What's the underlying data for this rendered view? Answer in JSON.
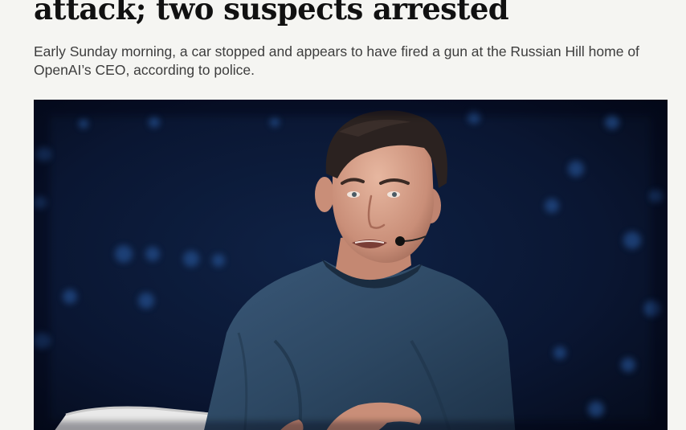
{
  "article": {
    "headline": "attack; two suspects arrested",
    "dek": "Early Sunday morning, a car stopped and appears to have fired a gun at the Russian Hill home of OpenAI’s CEO, according to police."
  },
  "hero_image": {
    "subject": "photo-of-speaker-on-stage"
  },
  "colors": {
    "page_background": "#f5f5f2",
    "headline_text": "#111111",
    "dek_text": "#3d3d3d",
    "photo_backdrop": "#081126",
    "shirt": "#2d4863"
  }
}
